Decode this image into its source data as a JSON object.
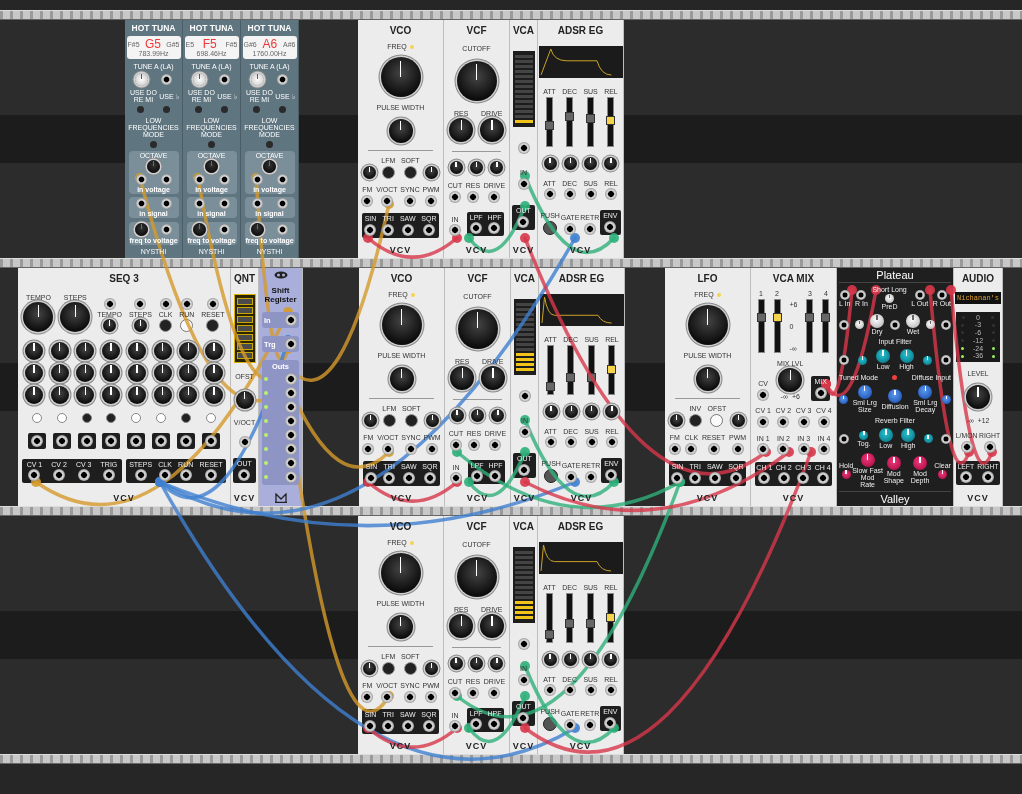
{
  "rack": {
    "rows": [
      {
        "modules": [
          {
            "kind": "hot_tuna",
            "title": "HOT TUNA",
            "note": "G5",
            "low_note": "F#5",
            "high_note": "G#5",
            "freq": "783.99Hz",
            "tune_label": "TUNE A (LA)",
            "solfege_label": "USE DO RE MI",
            "flat_label": "USE ♭",
            "lf_label": "LOW FREQUENCIES MODE",
            "octave_label": "OCTAVE",
            "voltage_label": "in voltage",
            "signal_label": "in signal",
            "ftv_label": "freq to voltage",
            "brand": "NYSTHI"
          },
          {
            "kind": "hot_tuna",
            "title": "HOT TUNA",
            "note": "F5",
            "low_note": "E5",
            "high_note": "F#5",
            "freq": "698.46Hz",
            "tune_label": "TUNE A (LA)",
            "solfege_label": "USE DO RE MI",
            "flat_label": "USE ♭",
            "lf_label": "LOW FREQUENCIES MODE",
            "octave_label": "OCTAVE",
            "voltage_label": "in voltage",
            "signal_label": "in signal",
            "ftv_label": "freq to voltage",
            "brand": "NYSTHI"
          },
          {
            "kind": "hot_tuna",
            "title": "HOT TUNA",
            "note": "A6",
            "low_note": "G#6",
            "high_note": "A#6",
            "freq": "1760.00Hz",
            "tune_label": "TUNE A (LA)",
            "solfege_label": "USE DO RE MI",
            "flat_label": "USE ♭",
            "lf_label": "LOW FREQUENCIES MODE",
            "octave_label": "OCTAVE",
            "voltage_label": "in voltage",
            "signal_label": "in signal",
            "ftv_label": "freq to voltage",
            "brand": "NYSTHI"
          },
          {
            "kind": "vco",
            "title": "VCO",
            "freq_label": "FREQ",
            "pw_label": "PULSE WIDTH",
            "buttons": [
              {
                "label": "LFM",
                "on": false
              },
              {
                "label": "SOFT",
                "on": false
              }
            ],
            "inputs": [
              "FM",
              "V/OCT",
              "SYNC",
              "PWM"
            ],
            "outputs": [
              "SIN",
              "TRI",
              "SAW",
              "SQR"
            ],
            "brand": "VCV"
          },
          {
            "kind": "vcf",
            "title": "VCF",
            "cutoff_label": "CUTOFF",
            "knob_labels": [
              "RES",
              "DRIVE"
            ],
            "cv_labels": [
              "CUT",
              "RES",
              "DRIVE"
            ],
            "input": "IN",
            "outputs": [
              "LPF",
              "HPF"
            ],
            "brand": "VCV"
          },
          {
            "kind": "vca",
            "title": "VCA",
            "level": 0.05,
            "input": "IN",
            "output": "OUT",
            "brand": "VCV"
          },
          {
            "kind": "adsr",
            "title": "ADSR EG",
            "sliders": [
              {
                "label": "ATT",
                "level": 0.4,
                "highlighted": false
              },
              {
                "label": "DEC",
                "level": 0.6,
                "highlighted": false
              },
              {
                "label": "SUS",
                "level": 0.55,
                "highlighted": false
              },
              {
                "label": "REL",
                "level": 0.52,
                "highlighted": true
              }
            ],
            "cv_labels": [
              "ATT",
              "DEC",
              "SUS",
              "REL"
            ],
            "push_label": "PUSH",
            "inputs": [
              "GATE",
              "RETR"
            ],
            "output": "ENV",
            "brand": "VCV"
          }
        ]
      },
      {
        "modules": [
          {
            "kind": "seq3",
            "title": "SEQ 3",
            "big_knobs": [
              "TEMPO",
              "STEPS"
            ],
            "controls": [
              {
                "label": "TEMPO",
                "kind": "knob"
              },
              {
                "label": "STEPS",
                "kind": "knob"
              },
              {
                "label": "CLK",
                "kind": "button",
                "on": false
              },
              {
                "label": "RUN",
                "kind": "button",
                "on": true
              },
              {
                "label": "RESET",
                "kind": "button",
                "on": false
              }
            ],
            "gates": [
              {
                "on": true
              },
              {
                "on": true
              },
              {
                "on": false
              },
              {
                "on": false
              },
              {
                "on": true
              },
              {
                "on": true
              },
              {
                "on": false
              },
              {
                "on": true
              }
            ],
            "outputs": [
              "CV 1",
              "CV 2",
              "CV 3",
              "TRIG"
            ],
            "inputs": [
              "STEPS",
              "CLK",
              "RUN",
              "RESET"
            ],
            "brand": "VCV"
          },
          {
            "kind": "qnt",
            "title": "QNT",
            "offset_label": "OFST",
            "input": "V/OCT",
            "output": "OUT",
            "brand": "VCV"
          },
          {
            "kind": "shift_register",
            "title": "Shift Register",
            "input": "In",
            "trigger": "Trg",
            "outputs_label": "Outs"
          },
          {
            "kind": "vco",
            "title": "VCO",
            "freq_label": "FREQ",
            "pw_label": "PULSE WIDTH",
            "buttons": [
              {
                "label": "LFM",
                "on": false
              },
              {
                "label": "SOFT",
                "on": false
              }
            ],
            "inputs": [
              "FM",
              "V/OCT",
              "SYNC",
              "PWM"
            ],
            "outputs": [
              "SIN",
              "TRI",
              "SAW",
              "SQR"
            ],
            "brand": "VCV"
          },
          {
            "kind": "vcf",
            "title": "VCF",
            "cutoff_label": "CUTOFF",
            "knob_labels": [
              "RES",
              "DRIVE"
            ],
            "cv_labels": [
              "CUT",
              "RES",
              "DRIVE"
            ],
            "input": "IN",
            "outputs": [
              "LPF",
              "HPF"
            ],
            "brand": "VCV"
          },
          {
            "kind": "vca",
            "title": "VCA",
            "level": 0.25,
            "input": "IN",
            "output": "OUT",
            "brand": "VCV"
          },
          {
            "kind": "adsr",
            "title": "ADSR EG",
            "sliders": [
              {
                "label": "ATT",
                "level": 0.07,
                "highlighted": false
              },
              {
                "label": "DEC",
                "level": 0.3,
                "highlighted": false
              },
              {
                "label": "SUS",
                "level": 0.28,
                "highlighted": false
              },
              {
                "label": "REL",
                "level": 0.48,
                "highlighted": true
              }
            ],
            "cv_labels": [
              "ATT",
              "DEC",
              "SUS",
              "REL"
            ],
            "push_label": "PUSH",
            "inputs": [
              "GATE",
              "RETR"
            ],
            "output": "ENV",
            "brand": "VCV"
          },
          {
            "kind": "lfo",
            "title": "LFO",
            "freq_label": "FREQ",
            "pw_label": "PULSE WIDTH",
            "buttons": [
              {
                "label": "INV",
                "on": false
              },
              {
                "label": "OFST",
                "on": true
              }
            ],
            "inputs": [
              "FM",
              "CLK",
              "RESET",
              "PWM"
            ],
            "outputs": [
              "SIN",
              "TRI",
              "SAW",
              "SQR"
            ],
            "brand": "VCV"
          },
          {
            "kind": "vca_mix",
            "title": "VCA MIX",
            "channels": [
              {
                "label": "1",
                "level": 0.69,
                "highlighted": false
              },
              {
                "label": "2",
                "level": 0.69,
                "highlighted": true
              },
              {
                "label": "3",
                "level": 0.69,
                "highlighted": false
              },
              {
                "label": "4",
                "level": 0.69,
                "highlighted": false
              }
            ],
            "scale": [
              "+6",
              "0",
              "-∞"
            ],
            "cv_label": "CV",
            "mix_label": "MIX LVL",
            "knob_min": "-∞",
            "knob_max": "+6",
            "mix_out": "MIX",
            "cv_inputs": [
              "CV 1",
              "CV 2",
              "CV 3",
              "CV 4"
            ],
            "inputs": [
              "IN 1",
              "IN 2",
              "IN 3",
              "IN 4"
            ],
            "outputs": [
              "CH 1",
              "CH 2",
              "CH 3",
              "CH 4"
            ],
            "brand": "VCV"
          },
          {
            "kind": "plateau",
            "title": "Plateau",
            "in_jacks": [
              "L In",
              "R In"
            ],
            "out_jacks": [
              "L Out",
              "R Out"
            ],
            "pred_short": "Short",
            "pred_long": "Long",
            "pred": "PreD",
            "dry": "Dry",
            "wet": "Wet",
            "input_filter": "Input Filter",
            "in_low": "Low",
            "in_high": "High",
            "tuned_mode": "Tuned Mode",
            "diffuse_input": "Diffuse Input",
            "size_min": "Sml",
            "size_max": "Lrg",
            "size": "Size",
            "diffusion": "Diffusion",
            "decay_min": "Sml",
            "decay_max": "Lrg",
            "decay": "Decay",
            "reverb_filter": "Reverb Filter",
            "tog": "Tog.",
            "rev_low": "Low",
            "rev_high": "High",
            "hold": "Hold",
            "clear": "Clear",
            "rate_min": "Slow",
            "rate_max": "Fast",
            "mod_rate": "Mod Rate",
            "mod_shape": "Mod Shape",
            "mod_depth": "Mod Depth",
            "brand": "Valley"
          },
          {
            "kind": "audio",
            "title": "AUDIO",
            "device": "Nichanan's",
            "meter": [
              {
                "label": "0",
                "lit": false
              },
              {
                "label": "-3",
                "lit": false
              },
              {
                "label": "-6",
                "lit": false
              },
              {
                "label": "-12",
                "lit": false
              },
              {
                "label": "-24",
                "lit": true
              },
              {
                "label": "-36",
                "lit": true
              }
            ],
            "level_label": "LEVEL",
            "knob_min": "-∞",
            "knob_max": "+12",
            "inputs": [
              "L/MON",
              "RIGHT"
            ],
            "outputs": [
              "LEFT",
              "RIGHT"
            ],
            "brand": "VCV"
          }
        ]
      },
      {
        "modules": [
          {
            "kind": "vco",
            "title": "VCO",
            "freq_label": "FREQ",
            "pw_label": "PULSE WIDTH",
            "buttons": [
              {
                "label": "LFM",
                "on": false
              },
              {
                "label": "SOFT",
                "on": false
              }
            ],
            "inputs": [
              "FM",
              "V/OCT",
              "SYNC",
              "PWM"
            ],
            "outputs": [
              "SIN",
              "TRI",
              "SAW",
              "SQR"
            ],
            "brand": "VCV"
          },
          {
            "kind": "vcf",
            "title": "VCF",
            "cutoff_label": "CUTOFF",
            "knob_labels": [
              "RES",
              "DRIVE"
            ],
            "cv_labels": [
              "CUT",
              "RES",
              "DRIVE"
            ],
            "input": "IN",
            "outputs": [
              "LPF",
              "HPF"
            ],
            "brand": "VCV"
          },
          {
            "kind": "vca",
            "title": "VCA",
            "level": 0.25,
            "input": "IN",
            "output": "OUT",
            "brand": "VCV"
          },
          {
            "kind": "adsr",
            "title": "ADSR EG",
            "sliders": [
              {
                "label": "ATT",
                "level": 0.07,
                "highlighted": false
              },
              {
                "label": "DEC",
                "level": 0.35,
                "highlighted": false
              },
              {
                "label": "SUS",
                "level": 0.35,
                "highlighted": false
              },
              {
                "label": "REL",
                "level": 0.5,
                "highlighted": true
              }
            ],
            "cv_labels": [
              "ATT",
              "DEC",
              "SUS",
              "REL"
            ],
            "push_label": "PUSH",
            "inputs": [
              "GATE",
              "RETR"
            ],
            "output": "ENV",
            "brand": "VCV"
          }
        ]
      }
    ]
  }
}
